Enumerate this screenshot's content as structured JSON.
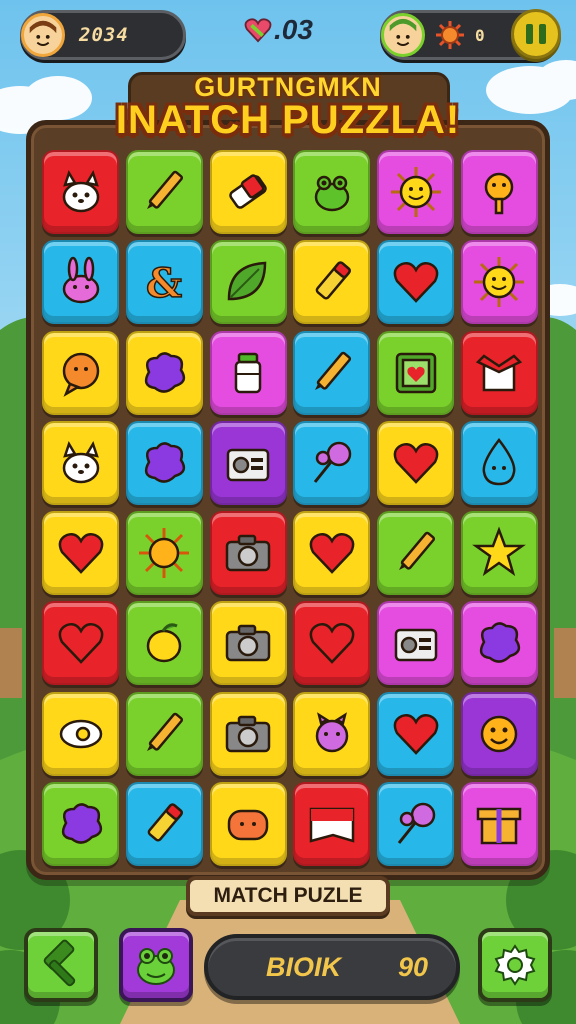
{
  "hud": {
    "coins": "2034",
    "lives": ".03",
    "energy": "0"
  },
  "title": {
    "line1": "GURTNGMKN",
    "line2": "INATCH PUZZLA!"
  },
  "board": {
    "rows": [
      [
        {
          "color": "red",
          "icon": "dog-icon"
        },
        {
          "color": "green",
          "icon": "pencil-icon"
        },
        {
          "color": "yellow",
          "icon": "eraser-icon"
        },
        {
          "color": "green",
          "icon": "frog-icon"
        },
        {
          "color": "pink",
          "icon": "sun-face-icon"
        },
        {
          "color": "pink",
          "icon": "bird-icon"
        }
      ],
      [
        {
          "color": "blue",
          "icon": "bunny-icon"
        },
        {
          "color": "blue",
          "icon": "ampersand-icon"
        },
        {
          "color": "green",
          "icon": "leaf-icon"
        },
        {
          "color": "yellow",
          "icon": "crayon-icon"
        },
        {
          "color": "blue",
          "icon": "heart-icon"
        },
        {
          "color": "pink",
          "icon": "sun-face-icon"
        }
      ],
      [
        {
          "color": "yellow",
          "icon": "chat-bubble-icon"
        },
        {
          "color": "yellow",
          "icon": "blob-icon"
        },
        {
          "color": "pink",
          "icon": "jar-icon"
        },
        {
          "color": "blue",
          "icon": "pencil-icon"
        },
        {
          "color": "green",
          "icon": "frame-heart-icon"
        },
        {
          "color": "red",
          "icon": "ribbon-icon"
        }
      ],
      [
        {
          "color": "yellow",
          "icon": "dog-icon"
        },
        {
          "color": "blue",
          "icon": "blob-icon"
        },
        {
          "color": "purple",
          "icon": "radio-icon"
        },
        {
          "color": "blue",
          "icon": "lollipop-icon"
        },
        {
          "color": "yellow",
          "icon": "heart-icon"
        },
        {
          "color": "blue",
          "icon": "drop-icon"
        }
      ],
      [
        {
          "color": "yellow",
          "icon": "heart-icon"
        },
        {
          "color": "green",
          "icon": "sun-icon"
        },
        {
          "color": "red",
          "icon": "camera-icon"
        },
        {
          "color": "yellow",
          "icon": "heart-icon"
        },
        {
          "color": "green",
          "icon": "pencil-icon"
        },
        {
          "color": "green",
          "icon": "star-icon"
        }
      ],
      [
        {
          "color": "red",
          "icon": "heart-icon"
        },
        {
          "color": "green",
          "icon": "lemon-icon"
        },
        {
          "color": "yellow",
          "icon": "camera-icon"
        },
        {
          "color": "red",
          "icon": "heart-icon"
        },
        {
          "color": "pink",
          "icon": "radio-icon"
        },
        {
          "color": "pink",
          "icon": "blob-icon"
        }
      ],
      [
        {
          "color": "yellow",
          "icon": "eye-icon"
        },
        {
          "color": "green",
          "icon": "pencil-icon"
        },
        {
          "color": "yellow",
          "icon": "camera-icon"
        },
        {
          "color": "yellow",
          "icon": "pig-icon"
        },
        {
          "color": "blue",
          "icon": "heart-icon"
        },
        {
          "color": "purple",
          "icon": "smiley-icon"
        }
      ],
      [
        {
          "color": "green",
          "icon": "blob-icon"
        },
        {
          "color": "blue",
          "icon": "crayon-icon"
        },
        {
          "color": "yellow",
          "icon": "face-icon"
        },
        {
          "color": "red",
          "icon": "flag-icon"
        },
        {
          "color": "blue",
          "icon": "lollipop-icon"
        },
        {
          "color": "pink",
          "icon": "gift-icon"
        }
      ]
    ]
  },
  "bottom": {
    "plate_label": "MATCH PUZLE",
    "score_label": "BIOIK",
    "score_value": "90"
  },
  "colors": {
    "red": "#e8232a",
    "green": "#7ad12c",
    "yellow": "#ffd81a",
    "pink": "#e54ce0",
    "blue": "#27b7e8",
    "purple": "#9a36d6"
  }
}
